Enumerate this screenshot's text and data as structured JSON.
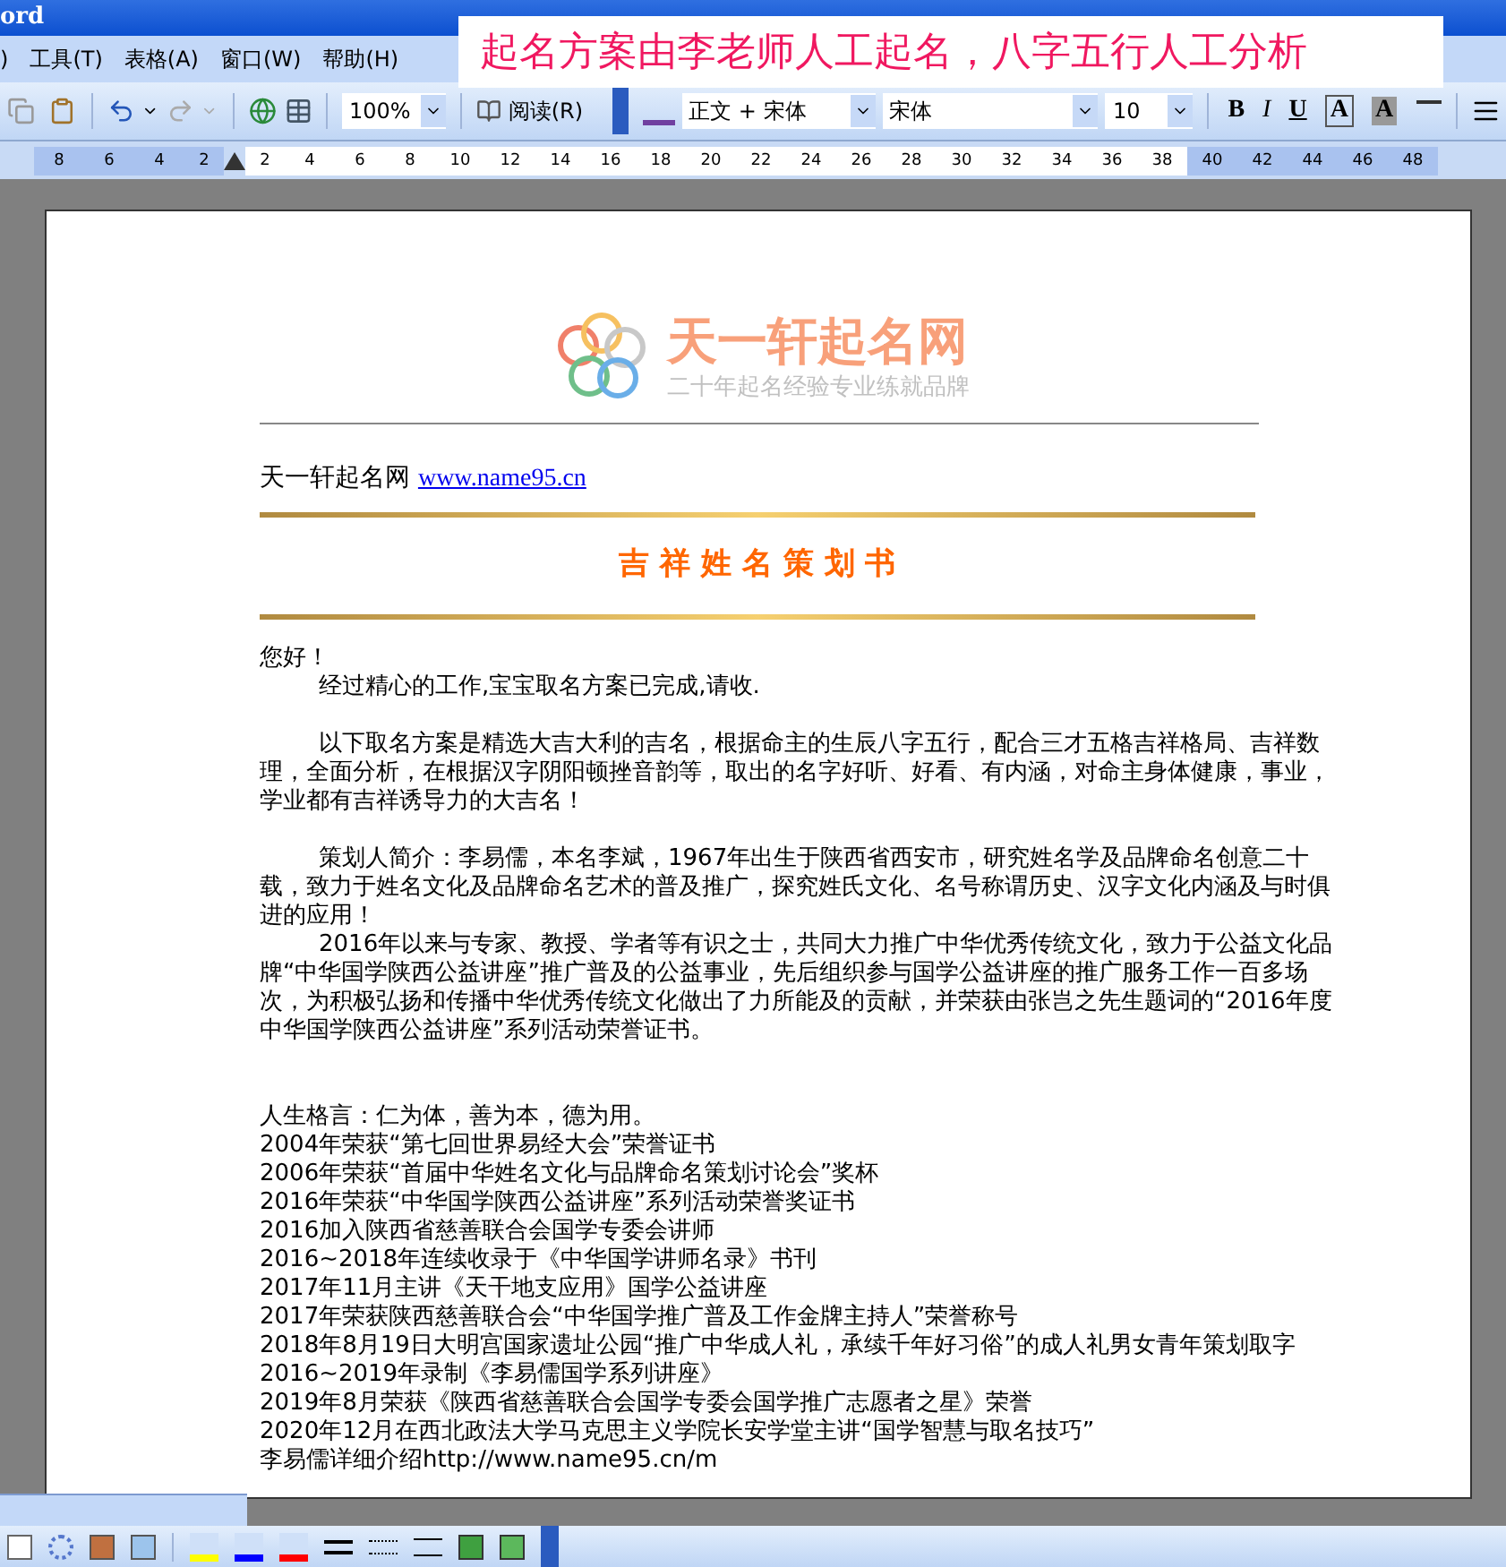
{
  "title_bar": {
    "title": "ord"
  },
  "menu": [
    {
      "label": ")"
    },
    {
      "label": "工具(T)"
    },
    {
      "label": "表格(A)"
    },
    {
      "label": "窗口(W)"
    },
    {
      "label": "帮助(H)"
    }
  ],
  "banner": {
    "text": "起名方案由李老师人工起名，八字五行人工分析"
  },
  "toolbar": {
    "zoom": "100%",
    "read_button": "阅读(R)",
    "style": "正文 + 宋体",
    "font": "宋体",
    "size": "10",
    "format_buttons": [
      {
        "label": "B",
        "kind": "bold"
      },
      {
        "label": "I",
        "kind": "italic"
      },
      {
        "label": "U",
        "kind": "underline"
      },
      {
        "label": "A",
        "kind": "boxed"
      },
      {
        "label": "A",
        "kind": "shaded"
      }
    ]
  },
  "ruler": {
    "labels": [
      {
        "text": "8",
        "margin": true
      },
      {
        "text": "6",
        "margin": true
      },
      {
        "text": "4",
        "margin": true
      },
      {
        "text": "2",
        "margin": true
      },
      {
        "text": "2",
        "margin": false
      },
      {
        "text": "4",
        "margin": false
      },
      {
        "text": "6",
        "margin": false
      },
      {
        "text": "8",
        "margin": false
      },
      {
        "text": "10",
        "margin": false
      },
      {
        "text": "12",
        "margin": false
      },
      {
        "text": "14",
        "margin": false
      },
      {
        "text": "16",
        "margin": false
      },
      {
        "text": "18",
        "margin": false
      },
      {
        "text": "20",
        "margin": false
      },
      {
        "text": "22",
        "margin": false
      },
      {
        "text": "24",
        "margin": false
      },
      {
        "text": "26",
        "margin": false
      },
      {
        "text": "28",
        "margin": false
      },
      {
        "text": "30",
        "margin": false
      },
      {
        "text": "32",
        "margin": false
      },
      {
        "text": "34",
        "margin": false
      },
      {
        "text": "36",
        "margin": false
      },
      {
        "text": "38",
        "margin": false
      },
      {
        "text": "40",
        "margin": true
      },
      {
        "text": "42",
        "margin": true
      },
      {
        "text": "44",
        "margin": true
      },
      {
        "text": "46",
        "margin": true
      },
      {
        "text": "48",
        "margin": true
      }
    ]
  },
  "document": {
    "logo_name": "天一轩起名网",
    "logo_tagline": "二十年起名经验专业练就品牌",
    "site_line": {
      "label": "天一轩起名网",
      "link": "www.name95.cn"
    },
    "heading": "吉 祥 姓 名 策 划 书",
    "paragraphs": [
      {
        "kind": "plain",
        "text": "您好！"
      },
      {
        "kind": "indented",
        "text": "经过精心的工作,宝宝取名方案已完成,请收."
      },
      {
        "kind": "blank"
      },
      {
        "kind": "indented",
        "text": "以下取名方案是精选大吉大利的吉名，根据命主的生辰八字五行，配合三才五格吉祥格局、吉祥数理，全面分析，在根据汉字阴阳顿挫音韵等，取出的名字好听、好看、有内涵，对命主身体健康，事业，学业都有吉祥诱导力的大吉名！"
      },
      {
        "kind": "blank"
      },
      {
        "kind": "indented",
        "text": "策划人简介：李易儒，本名李斌，1967年出生于陕西省西安市，研究姓名学及品牌命名创意二十载，致力于姓名文化及品牌命名艺术的普及推广，探究姓氏文化、名号称谓历史、汉字文化内涵及与时俱进的应用！"
      },
      {
        "kind": "indented",
        "text": "2016年以来与专家、教授、学者等有识之士，共同大力推广中华优秀传统文化，致力于公益文化品牌“中华国学陕西公益讲座”推广普及的公益事业，先后组织参与国学公益讲座的推广服务工作一百多场次，为积极弘扬和传播中华优秀传统文化做出了力所能及的贡献，并荣获由张岂之先生题词的“2016年度中华国学陕西公益讲座”系列活动荣誉证书。"
      },
      {
        "kind": "blank"
      },
      {
        "kind": "blank"
      },
      {
        "kind": "plain",
        "text": "人生格言：仁为体，善为本，德为用。"
      },
      {
        "kind": "plain",
        "text": "2004年荣获“第七回世界易经大会”荣誉证书"
      },
      {
        "kind": "plain",
        "text": "2006年荣获“首届中华姓名文化与品牌命名策划讨论会”奖杯"
      },
      {
        "kind": "plain",
        "text": "2016年荣获“中华国学陕西公益讲座”系列活动荣誉奖证书"
      },
      {
        "kind": "plain",
        "text": "2016加入陕西省慈善联合会国学专委会讲师"
      },
      {
        "kind": "plain",
        "text": "2016~2018年连续收录于《中华国学讲师名录》书刊"
      },
      {
        "kind": "plain",
        "text": "2017年11月主讲《天干地支应用》国学公益讲座"
      },
      {
        "kind": "plain",
        "text": "2017年荣获陕西慈善联合会“中华国学推广普及工作金牌主持人”荣誉称号"
      },
      {
        "kind": "plain",
        "text": "2018年8月19日大明宫国家遗址公园“推广中华成人礼，承续千年好习俗”的成人礼男女青年策划取字"
      },
      {
        "kind": "plain",
        "text": "2016~2019年录制《李易儒国学系列讲座》"
      },
      {
        "kind": "plain",
        "text": "2019年8月荣获《陕西省慈善联合会国学专委会国学推广志愿者之星》荣誉"
      },
      {
        "kind": "plain",
        "text": "2020年12月在西北政法大学马克思主义学院长安学堂主讲“国学智慧与取名技巧”"
      },
      {
        "kind": "plain",
        "text": "李易儒详细介绍http://www.name95.cn/m"
      }
    ]
  }
}
